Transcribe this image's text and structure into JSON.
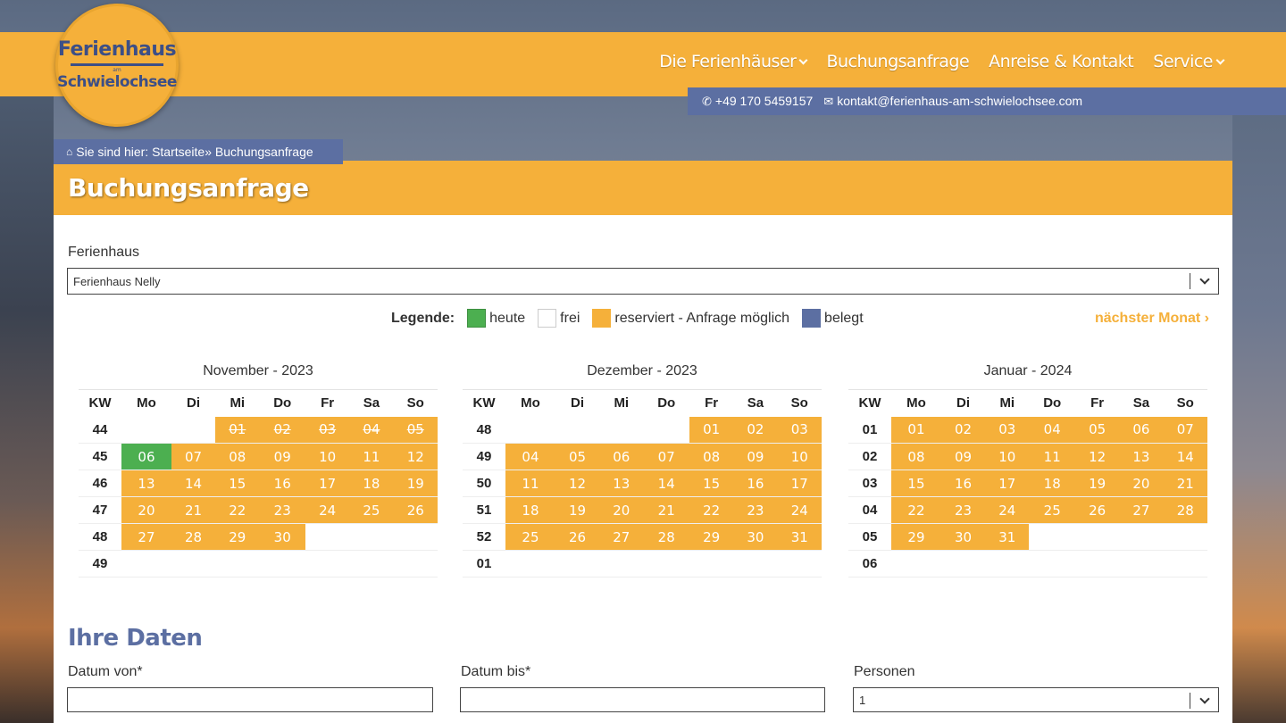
{
  "logo": {
    "line1": "Ferienhaus",
    "line2": "am",
    "line3": "Schwielochsee"
  },
  "nav": [
    {
      "label": "Die Ferienhäuser",
      "dropdown": true
    },
    {
      "label": "Buchungsanfrage",
      "dropdown": false
    },
    {
      "label": "Anreise & Kontakt",
      "dropdown": false
    },
    {
      "label": "Service",
      "dropdown": true
    }
  ],
  "contact": {
    "phone": "+49 170 5459157",
    "email": "kontakt@ferienhaus-am-schwielochsee.com"
  },
  "breadcrumb": {
    "prefix": "Sie sind hier:",
    "home": "Startseite»",
    "current": "Buchungsanfrage"
  },
  "page_title": "Buchungsanfrage",
  "ferienhaus": {
    "label": "Ferienhaus",
    "value": "Ferienhaus Nelly"
  },
  "legend": {
    "title": "Legende:",
    "items": [
      {
        "label": "heute",
        "color": "#4caf50"
      },
      {
        "label": "frei",
        "color": "#ffffff"
      },
      {
        "label": "reserviert - Anfrage möglich",
        "color": "#f5b03a"
      },
      {
        "label": "belegt",
        "color": "#5c6fa2"
      }
    ]
  },
  "next_month": "nächster Monat",
  "weekday_headers": [
    "KW",
    "Mo",
    "Di",
    "Mi",
    "Do",
    "Fr",
    "Sa",
    "So"
  ],
  "calendars": [
    {
      "title": "November - 2023",
      "rows": [
        {
          "kw": "44",
          "days": [
            "",
            "",
            "01",
            "02",
            "03",
            "04",
            "05"
          ],
          "status": [
            "",
            "",
            "p",
            "p",
            "p",
            "p",
            "p"
          ]
        },
        {
          "kw": "45",
          "days": [
            "06",
            "07",
            "08",
            "09",
            "10",
            "11",
            "12"
          ],
          "status": [
            "t",
            "r",
            "r",
            "r",
            "r",
            "r",
            "r"
          ]
        },
        {
          "kw": "46",
          "days": [
            "13",
            "14",
            "15",
            "16",
            "17",
            "18",
            "19"
          ],
          "status": [
            "r",
            "r",
            "r",
            "r",
            "r",
            "r",
            "r"
          ]
        },
        {
          "kw": "47",
          "days": [
            "20",
            "21",
            "22",
            "23",
            "24",
            "25",
            "26"
          ],
          "status": [
            "r",
            "r",
            "r",
            "r",
            "r",
            "r",
            "r"
          ]
        },
        {
          "kw": "48",
          "days": [
            "27",
            "28",
            "29",
            "30",
            "",
            "",
            ""
          ],
          "status": [
            "r",
            "r",
            "r",
            "r",
            "",
            "",
            ""
          ]
        },
        {
          "kw": "49",
          "days": [
            "",
            "",
            "",
            "",
            "",
            "",
            ""
          ],
          "status": [
            "",
            "",
            "",
            "",
            "",
            "",
            ""
          ]
        }
      ]
    },
    {
      "title": "Dezember - 2023",
      "rows": [
        {
          "kw": "48",
          "days": [
            "",
            "",
            "",
            "",
            "01",
            "02",
            "03"
          ],
          "status": [
            "",
            "",
            "",
            "",
            "r",
            "r",
            "r"
          ]
        },
        {
          "kw": "49",
          "days": [
            "04",
            "05",
            "06",
            "07",
            "08",
            "09",
            "10"
          ],
          "status": [
            "r",
            "r",
            "r",
            "r",
            "r",
            "r",
            "r"
          ]
        },
        {
          "kw": "50",
          "days": [
            "11",
            "12",
            "13",
            "14",
            "15",
            "16",
            "17"
          ],
          "status": [
            "r",
            "r",
            "r",
            "r",
            "r",
            "r",
            "r"
          ]
        },
        {
          "kw": "51",
          "days": [
            "18",
            "19",
            "20",
            "21",
            "22",
            "23",
            "24"
          ],
          "status": [
            "r",
            "r",
            "r",
            "r",
            "r",
            "r",
            "r"
          ]
        },
        {
          "kw": "52",
          "days": [
            "25",
            "26",
            "27",
            "28",
            "29",
            "30",
            "31"
          ],
          "status": [
            "r",
            "r",
            "r",
            "r",
            "r",
            "r",
            "r"
          ]
        },
        {
          "kw": "01",
          "days": [
            "",
            "",
            "",
            "",
            "",
            "",
            ""
          ],
          "status": [
            "",
            "",
            "",
            "",
            "",
            "",
            ""
          ]
        }
      ]
    },
    {
      "title": "Januar - 2024",
      "rows": [
        {
          "kw": "01",
          "days": [
            "01",
            "02",
            "03",
            "04",
            "05",
            "06",
            "07"
          ],
          "status": [
            "r",
            "r",
            "r",
            "r",
            "r",
            "r",
            "r"
          ]
        },
        {
          "kw": "02",
          "days": [
            "08",
            "09",
            "10",
            "11",
            "12",
            "13",
            "14"
          ],
          "status": [
            "r",
            "r",
            "r",
            "r",
            "r",
            "r",
            "r"
          ]
        },
        {
          "kw": "03",
          "days": [
            "15",
            "16",
            "17",
            "18",
            "19",
            "20",
            "21"
          ],
          "status": [
            "r",
            "r",
            "r",
            "r",
            "r",
            "r",
            "r"
          ]
        },
        {
          "kw": "04",
          "days": [
            "22",
            "23",
            "24",
            "25",
            "26",
            "27",
            "28"
          ],
          "status": [
            "r",
            "r",
            "r",
            "r",
            "r",
            "r",
            "r"
          ]
        },
        {
          "kw": "05",
          "days": [
            "29",
            "30",
            "31",
            "",
            "",
            "",
            ""
          ],
          "status": [
            "r",
            "r",
            "r",
            "",
            "",
            "",
            ""
          ]
        },
        {
          "kw": "06",
          "days": [
            "",
            "",
            "",
            "",
            "",
            "",
            ""
          ],
          "status": [
            "",
            "",
            "",
            "",
            "",
            "",
            ""
          ]
        }
      ]
    }
  ],
  "ihre_daten": {
    "title": "Ihre Daten",
    "datum_von": {
      "label": "Datum von*",
      "value": ""
    },
    "datum_bis": {
      "label": "Datum bis*",
      "value": ""
    },
    "personen": {
      "label": "Personen",
      "value": "1"
    }
  }
}
